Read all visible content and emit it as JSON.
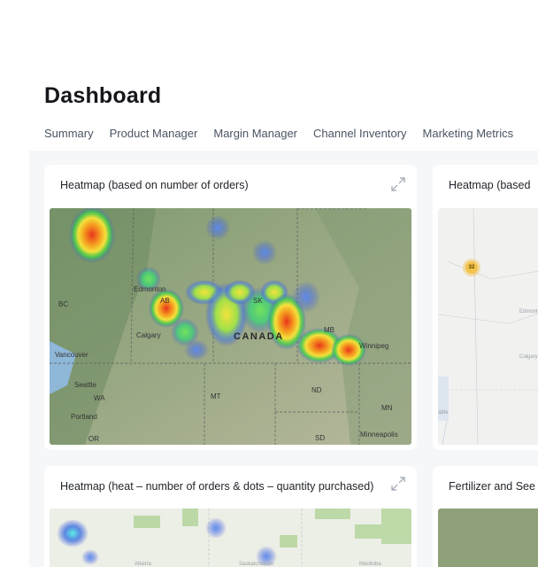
{
  "page": {
    "title": "Dashboard"
  },
  "tabs": [
    {
      "label": "Summary"
    },
    {
      "label": "Product Manager"
    },
    {
      "label": "Margin Manager"
    },
    {
      "label": "Channel Inventory"
    },
    {
      "label": "Marketing Metrics"
    }
  ],
  "cards": {
    "heatmap_orders": {
      "title": "Heatmap (based on number of orders)",
      "labels": {
        "edmonton": "Edmonton",
        "ab": "AB",
        "bc": "BC",
        "calgary": "Calgary",
        "vancouver": "Vancouver",
        "canada": "CANADA",
        "sk": "SK",
        "mb": "MB",
        "winnipeg": "Winnipeg",
        "seattle": "Seattle",
        "wa": "WA",
        "portland": "Portland",
        "or": "OR",
        "mt": "MT",
        "nd": "ND",
        "mn": "MN",
        "sd": "SD",
        "minneapolis": "Minneapolis"
      }
    },
    "heatmap_right_top": {
      "title": "Heatmap (based",
      "cluster_count": "32",
      "labels": {
        "edmonton": "Edmont",
        "calgary": "Calgary",
        "seattle": "attle"
      }
    },
    "heatmap_heat_dots": {
      "title": "Heatmap (heat – number of orders & dots – quantity purchased)",
      "labels": {
        "alberta": "Alberta",
        "saskatchewan": "Saskatchewan",
        "manitoba": "Manitoba"
      }
    },
    "fertilizer": {
      "title": "Fertilizer and See"
    }
  },
  "colors": {
    "heat_red": "#e8361c",
    "heat_orange": "#f59a1f",
    "heat_yellow": "#f3e23b",
    "heat_green": "#3ecf4a",
    "heat_blue": "#3a4fd8",
    "cluster": "#f3c24b"
  }
}
